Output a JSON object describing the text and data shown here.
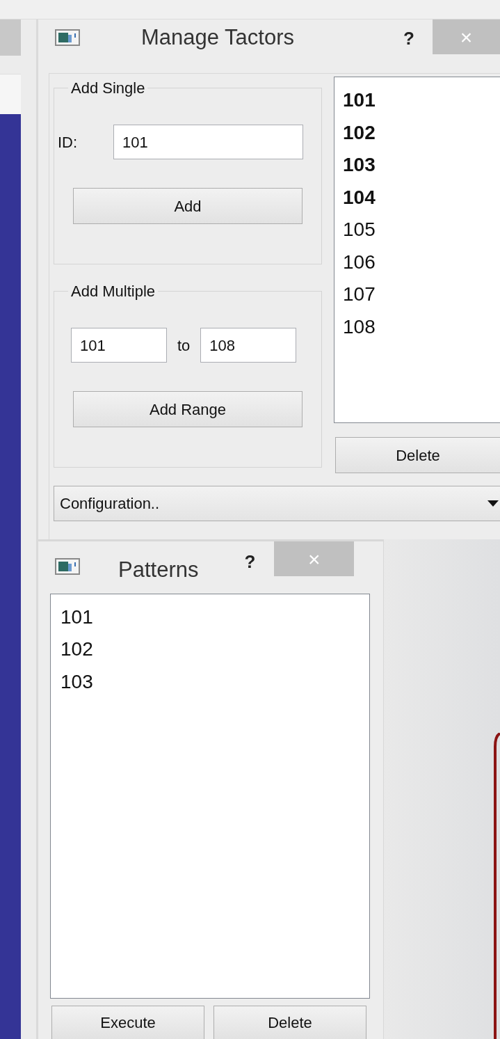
{
  "manage_tactors": {
    "title": "Manage Tactors",
    "help": "?",
    "close": "×",
    "add_single": {
      "title": "Add Single",
      "id_label": "ID:",
      "id_value": "101",
      "button": "Add"
    },
    "add_multiple": {
      "title": "Add Multiple",
      "from_value": "101",
      "to_label": "to",
      "to_value": "108",
      "button": "Add Range"
    },
    "tactors": [
      {
        "label": "101",
        "active": true
      },
      {
        "label": "102",
        "active": true
      },
      {
        "label": "103",
        "active": true
      },
      {
        "label": "104",
        "active": true
      },
      {
        "label": "105",
        "active": false
      },
      {
        "label": "106",
        "active": false
      },
      {
        "label": "107",
        "active": false
      },
      {
        "label": "108",
        "active": false
      }
    ],
    "delete_button": "Delete",
    "configuration": {
      "value": "Configuration.."
    }
  },
  "patterns": {
    "title": "Patterns",
    "help": "?",
    "close": "×",
    "items": [
      "101",
      "102",
      "103"
    ],
    "buttons": [
      "Execute",
      "Delete"
    ]
  }
}
